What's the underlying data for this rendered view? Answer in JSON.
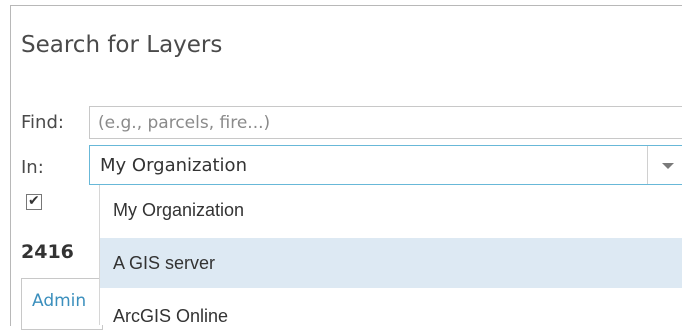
{
  "dialog": {
    "title": "Search for Layers",
    "find": {
      "label": "Find:",
      "placeholder": "(e.g., parcels, fire...)"
    },
    "in": {
      "label": "In:",
      "selected": "My Organization",
      "options": [
        "My Organization",
        "A GIS server",
        "ArcGIS Online"
      ],
      "highlighted_option": "A GIS server"
    },
    "checkbox": {
      "checked": true,
      "symbol": "✔"
    },
    "results_count": "2416",
    "first_result_link": "Admin"
  },
  "colors": {
    "select_border": "#68b8d8",
    "highlight": "#dde9f3",
    "link": "#3b8fbd"
  },
  "icons": [
    "chevron-down-icon",
    "checkmark-icon"
  ]
}
